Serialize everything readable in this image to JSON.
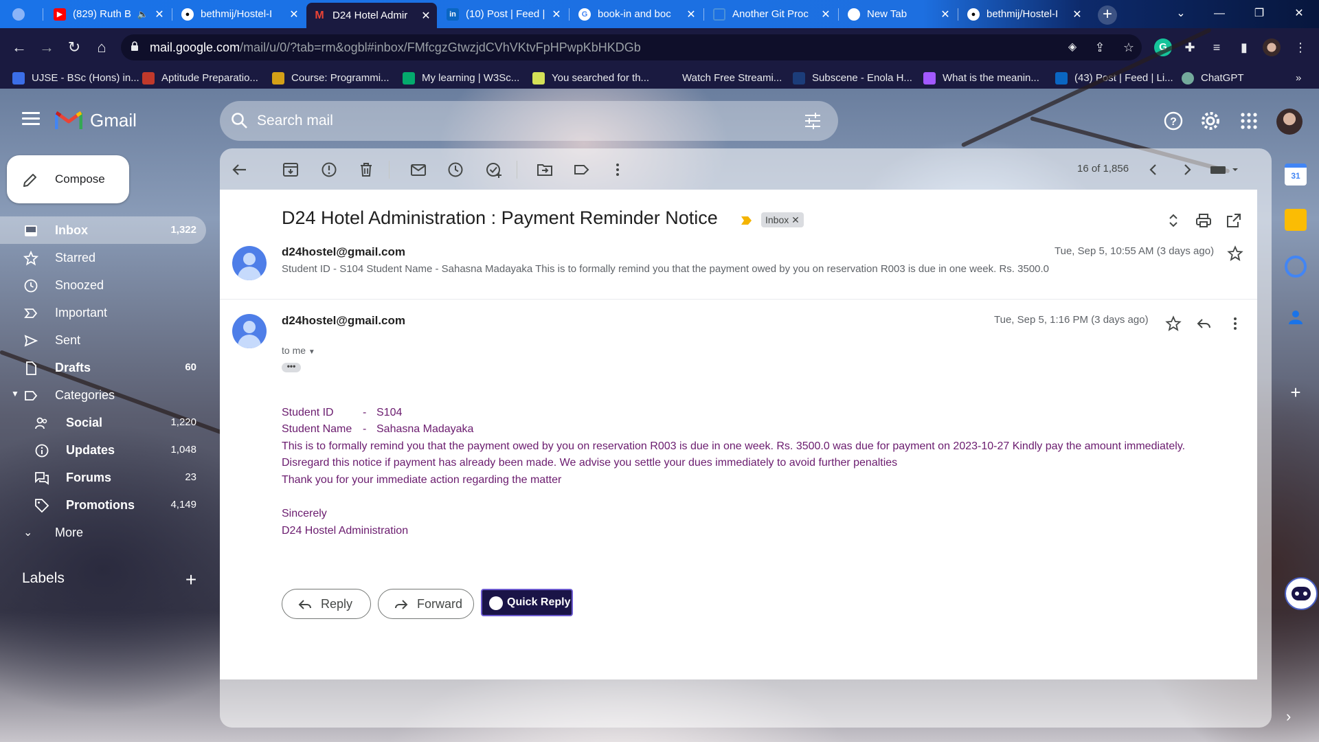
{
  "browser": {
    "tabs": [
      {
        "label": "(829) Ruth B",
        "icon_color": "#ff0000",
        "icon": "youtube-icon",
        "active": false
      },
      {
        "label": "bethmij/Hostel-I",
        "icon_color": "#ffffff",
        "icon": "github-icon",
        "active": false
      },
      {
        "label": "D24 Hotel Admir",
        "icon_color": "#ea4335",
        "icon": "gmail-icon",
        "active": true
      },
      {
        "label": "(10) Post | Feed |",
        "icon_color": "#0a66c2",
        "icon": "linkedin-icon",
        "active": false
      },
      {
        "label": "book-in and boc",
        "icon_color": "#ffffff",
        "icon": "google-icon",
        "active": false
      },
      {
        "label": "Another Git Proc",
        "icon_color": "#4a90d9",
        "icon": "page-icon",
        "active": false
      },
      {
        "label": "New Tab",
        "icon_color": "#ffffff",
        "icon": "chrome-icon",
        "active": false
      },
      {
        "label": "bethmij/Hostel-I",
        "icon_color": "#ffffff",
        "icon": "github-icon",
        "active": false
      }
    ],
    "url_host": "mail.google.com",
    "url_path": "/mail/u/0/?tab=rm&ogbl#inbox/FMfcgzGtwzjdCVhVKtvFpHPwpKbHKDGb",
    "bookmarks": [
      {
        "label": "UJSE - BSc (Hons) in...",
        "color": "#3b6ee8"
      },
      {
        "label": "Aptitude Preparatio...",
        "color": "#c0392b"
      },
      {
        "label": "Course: Programmi...",
        "color": "#d4a017"
      },
      {
        "label": "My learning | W3Sc...",
        "color": "#04aa6d"
      },
      {
        "label": "You searched for th...",
        "color": "#d4e157"
      },
      {
        "label": "Watch Free Streami...",
        "color": "#1a1a40"
      },
      {
        "label": "Subscene - Enola H...",
        "color": "#1c3d7a"
      },
      {
        "label": "What is the meanin...",
        "color": "#a259ff"
      },
      {
        "label": "(43) Post | Feed | Li...",
        "color": "#0a66c2"
      },
      {
        "label": "ChatGPT",
        "color": "#74aa9c"
      }
    ],
    "bookmarks_overflow": "»"
  },
  "gmail": {
    "logo_text": "Gmail",
    "search_placeholder": "Search mail",
    "compose_label": "Compose",
    "nav": [
      {
        "label": "Inbox",
        "count": "1,322",
        "icon": "inbox-icon",
        "bold": true,
        "active": true
      },
      {
        "label": "Starred",
        "count": "",
        "icon": "star-icon",
        "bold": false
      },
      {
        "label": "Snoozed",
        "count": "",
        "icon": "clock-icon",
        "bold": false
      },
      {
        "label": "Important",
        "count": "",
        "icon": "important-icon",
        "bold": false
      },
      {
        "label": "Sent",
        "count": "",
        "icon": "send-icon",
        "bold": false
      },
      {
        "label": "Drafts",
        "count": "60",
        "icon": "draft-icon",
        "bold": true
      },
      {
        "label": "Categories",
        "count": "",
        "icon": "label-icon",
        "bold": false
      }
    ],
    "categories": [
      {
        "label": "Social",
        "count": "1,220",
        "icon": "people-icon"
      },
      {
        "label": "Updates",
        "count": "1,048",
        "icon": "info-icon"
      },
      {
        "label": "Forums",
        "count": "23",
        "icon": "forum-icon"
      },
      {
        "label": "Promotions",
        "count": "4,149",
        "icon": "tag-icon"
      }
    ],
    "more_label": "More",
    "labels_heading": "Labels",
    "pager": "16 of 1,856"
  },
  "email": {
    "subject": "D24 Hotel Administration : Payment Reminder Notice",
    "label_chip": "Inbox",
    "messages": [
      {
        "sender": "d24hostel@gmail.com",
        "date": "Tue, Sep 5, 10:55 AM (3 days ago)",
        "snippet": "Student ID - S104 Student Name - Sahasna Madayaka This is to formally remind you that the payment owed by you on reservation R003 is due in one week. Rs. 3500.0"
      },
      {
        "sender": "d24hostel@gmail.com",
        "date": "Tue, Sep 5, 1:16 PM (3 days ago)",
        "to": "to me"
      }
    ],
    "body": {
      "student_id_label": "Student ID",
      "student_id_sep": "-",
      "student_id": "S104",
      "student_name_label": "Student Name",
      "student_name_sep": "-",
      "student_name": "Sahasna Madayaka",
      "line1": "This is to formally remind you that the payment owed by you on reservation R003 is due in one week. Rs. 3500.0 was due for payment on 2023-10-27 Kindly pay the amount immediately.",
      "line2": "Disregard this notice if payment has already been made. We advise you settle your dues immediately to avoid further penalties",
      "line3": "Thank you for your immediate action regarding the matter",
      "closing": "Sincerely",
      "signature": "D24 Hostel Administration"
    },
    "actions": {
      "reply": "Reply",
      "forward": "Forward",
      "quick_reply": "Quick Reply"
    }
  }
}
